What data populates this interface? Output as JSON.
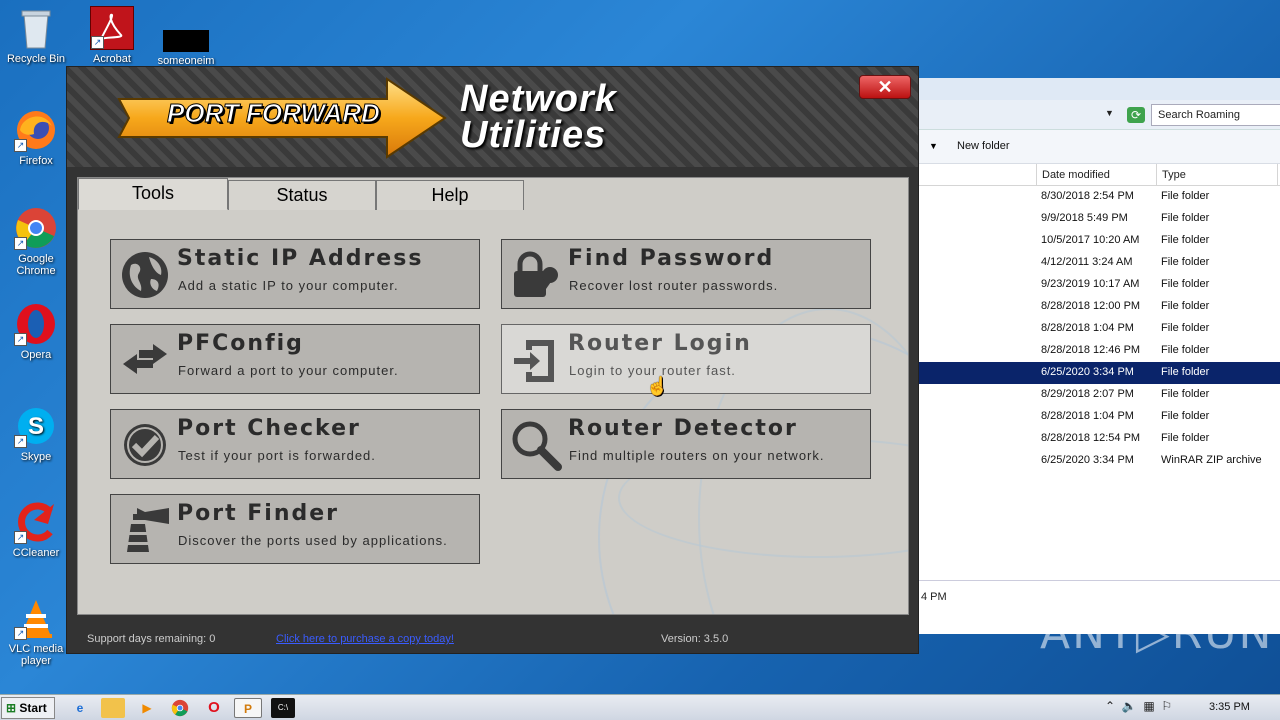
{
  "desktop": {
    "icons": [
      {
        "label": "Recycle Bin"
      },
      {
        "label": "Acrobat"
      },
      {
        "label": "someoneim"
      },
      {
        "label": "Firefox"
      },
      {
        "label": "Google Chrome"
      },
      {
        "label": "Opera"
      },
      {
        "label": "Skype"
      },
      {
        "label": "CCleaner"
      },
      {
        "label": "VLC media player"
      }
    ]
  },
  "explorer": {
    "search_placeholder": "Search Roaming",
    "toolbar_new_folder": "New folder",
    "columns": [
      "Date modified",
      "Type"
    ],
    "rows": [
      {
        "date": "8/30/2018 2:54 PM",
        "type": "File folder"
      },
      {
        "date": "9/9/2018 5:49 PM",
        "type": "File folder"
      },
      {
        "date": "10/5/2017 10:20 AM",
        "type": "File folder"
      },
      {
        "date": "4/12/2011 3:24 AM",
        "type": "File folder"
      },
      {
        "date": "9/23/2019 10:17 AM",
        "type": "File folder"
      },
      {
        "date": "8/28/2018 12:00 PM",
        "type": "File folder"
      },
      {
        "date": "8/28/2018 1:04 PM",
        "type": "File folder"
      },
      {
        "date": "8/28/2018 12:46 PM",
        "type": "File folder"
      },
      {
        "date": "6/25/2020 3:34 PM",
        "type": "File folder"
      },
      {
        "date": "8/29/2018 2:07 PM",
        "type": "File folder"
      },
      {
        "date": "8/28/2018 1:04 PM",
        "type": "File folder"
      },
      {
        "date": "8/28/2018 12:54 PM",
        "type": "File folder"
      },
      {
        "date": "6/25/2020 3:34 PM",
        "type": "WinRAR ZIP archive"
      }
    ],
    "detail_text": "4 PM"
  },
  "app": {
    "brand": "PORT FORWARD",
    "title_line1": "Network",
    "title_line2": "Utilities",
    "close_label": "✕",
    "tabs": [
      {
        "label": "Tools"
      },
      {
        "label": "Status"
      },
      {
        "label": "Help"
      }
    ],
    "tiles": {
      "static_ip": {
        "title": "Static IP Address",
        "desc": "Add a static IP to your computer."
      },
      "find_password": {
        "title": "Find Password",
        "desc": "Recover lost router passwords."
      },
      "pfconfig": {
        "title": "PFConfig",
        "desc": "Forward a port to your computer."
      },
      "router_login": {
        "title": "Router Login",
        "desc": "Login to your router fast."
      },
      "port_checker": {
        "title": "Port Checker",
        "desc": "Test if your port is forwarded."
      },
      "router_detector": {
        "title": "Router Detector",
        "desc": "Find multiple routers on your network."
      },
      "port_finder": {
        "title": "Port Finder",
        "desc": "Discover the ports used by applications."
      }
    },
    "footer": {
      "support": "Support days remaining: 0",
      "purchase_link": "Click here to purchase a copy today!",
      "version": "Version: 3.5.0"
    }
  },
  "watermark": "ANY▷RUN",
  "taskbar": {
    "start_label": "Start",
    "clock": "3:35 PM"
  }
}
